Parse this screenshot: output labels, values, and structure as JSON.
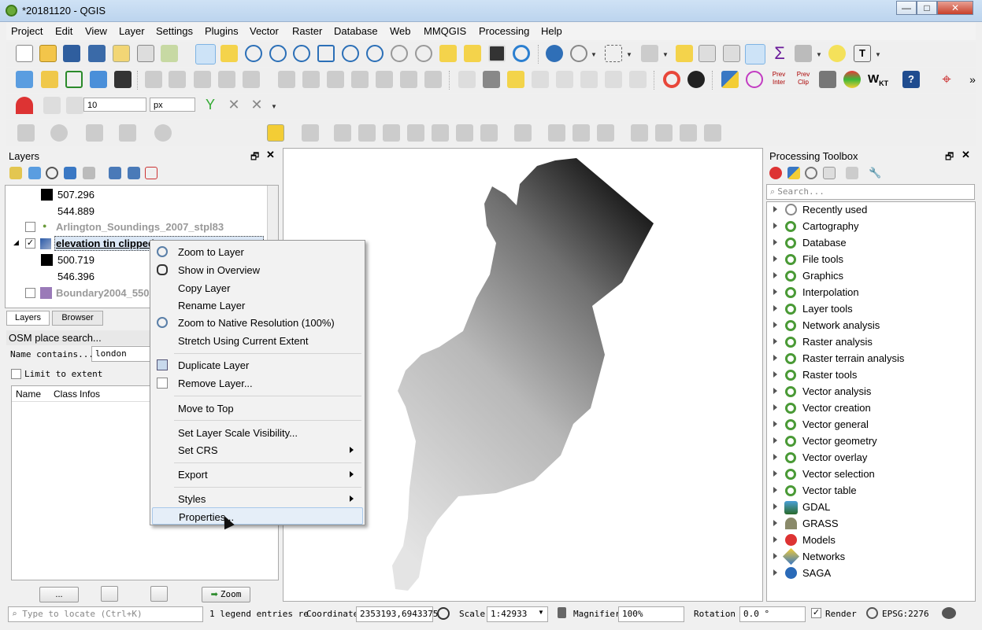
{
  "window": {
    "title": "*20181120 - QGIS",
    "min": "—",
    "max": "□",
    "close": "✕"
  },
  "menubar": [
    "Project",
    "Edit",
    "View",
    "Layer",
    "Settings",
    "Plugins",
    "Vector",
    "Raster",
    "Database",
    "Web",
    "MMQGIS",
    "Processing",
    "Help"
  ],
  "toolbar": {
    "width_value": "10",
    "width_unit": "px"
  },
  "layers_panel": {
    "title": "Layers",
    "rows": [
      {
        "label": "507.296",
        "kind": "legend"
      },
      {
        "label": "544.889",
        "kind": "legend"
      },
      {
        "label": "Arlington_Soundings_2007_stpl83",
        "kind": "layer"
      },
      {
        "label": "elevation tin clipped",
        "kind": "layer-active"
      },
      {
        "label": "500.719",
        "kind": "legend"
      },
      {
        "label": "546.396",
        "kind": "legend"
      },
      {
        "label": "Boundary2004_550_",
        "kind": "layer"
      }
    ],
    "tabs": [
      "Layers",
      "Browser"
    ]
  },
  "osm": {
    "title": "OSM place search...",
    "name_label": "Name contains...",
    "name_value": "london",
    "limit_label": "Limit to extent",
    "columns": [
      "Name",
      "Class",
      "Infos"
    ],
    "btn_more": "...",
    "btn_zoom": "Zoom"
  },
  "context_menu": {
    "items": [
      {
        "label": "Zoom to Layer",
        "icon": "zoom-layer-icon"
      },
      {
        "label": "Show in Overview",
        "icon": "overview-icon"
      },
      {
        "label": "Copy Layer"
      },
      {
        "label": "Rename Layer"
      },
      {
        "label": "Zoom to Native Resolution (100%)",
        "icon": "zoom-native-icon"
      },
      {
        "label": "Stretch Using Current Extent"
      },
      {
        "label": "Duplicate Layer",
        "icon": "duplicate-icon"
      },
      {
        "label": "Remove Layer...",
        "icon": "remove-layer-icon"
      },
      {
        "label": "Move to Top"
      },
      {
        "label": "Set Layer Scale Visibility..."
      },
      {
        "label": "Set CRS",
        "submenu": true
      },
      {
        "label": "Export",
        "submenu": true
      },
      {
        "label": "Styles",
        "submenu": true
      },
      {
        "label": "Properties...",
        "highlighted": true
      }
    ]
  },
  "toolbox": {
    "title": "Processing Toolbox",
    "search_placeholder": "Search...",
    "items": [
      {
        "label": "Recently used",
        "icon": "clock-icon"
      },
      {
        "label": "Cartography",
        "icon": "qgis-icon"
      },
      {
        "label": "Database",
        "icon": "qgis-icon"
      },
      {
        "label": "File tools",
        "icon": "qgis-icon"
      },
      {
        "label": "Graphics",
        "icon": "qgis-icon"
      },
      {
        "label": "Interpolation",
        "icon": "qgis-icon"
      },
      {
        "label": "Layer tools",
        "icon": "qgis-icon"
      },
      {
        "label": "Network analysis",
        "icon": "qgis-icon"
      },
      {
        "label": "Raster analysis",
        "icon": "qgis-icon"
      },
      {
        "label": "Raster terrain analysis",
        "icon": "qgis-icon"
      },
      {
        "label": "Raster tools",
        "icon": "qgis-icon"
      },
      {
        "label": "Vector analysis",
        "icon": "qgis-icon"
      },
      {
        "label": "Vector creation",
        "icon": "qgis-icon"
      },
      {
        "label": "Vector general",
        "icon": "qgis-icon"
      },
      {
        "label": "Vector geometry",
        "icon": "qgis-icon"
      },
      {
        "label": "Vector overlay",
        "icon": "qgis-icon"
      },
      {
        "label": "Vector selection",
        "icon": "qgis-icon"
      },
      {
        "label": "Vector table",
        "icon": "qgis-icon"
      },
      {
        "label": "GDAL",
        "icon": "gdal-icon"
      },
      {
        "label": "GRASS",
        "icon": "grass-icon"
      },
      {
        "label": "Models",
        "icon": "models-icon"
      },
      {
        "label": "Networks",
        "icon": "networks-icon"
      },
      {
        "label": "SAGA",
        "icon": "saga-icon"
      }
    ]
  },
  "statusbar": {
    "locate_placeholder": "Type to locate (Ctrl+K)",
    "legend_msg": "1 legend entries re",
    "coord_label": "Coordinate",
    "coord_value": "2353193,6943375",
    "scale_label": "Scale",
    "scale_value": "1:42933",
    "magnifier_label": "Magnifier",
    "magnifier_value": "100%",
    "rotation_label": "Rotation",
    "rotation_value": "0.0 °",
    "render_label": "Render",
    "crs": "EPSG:2276"
  }
}
